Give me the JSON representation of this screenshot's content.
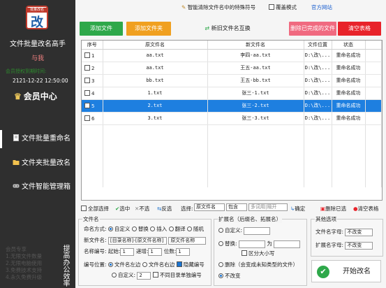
{
  "sidebar": {
    "logo_top": "批量改名",
    "logo_char": "改",
    "app_name": "文件批量改名高手",
    "owner": "与我",
    "valid_label": "会员授权到期时间:",
    "expiry": "2121-12-22 12:50:00",
    "vip": "会员中心",
    "nav": [
      {
        "label": "文件批量重命名"
      },
      {
        "label": "文件夹批量改名"
      },
      {
        "label": "文件智能管理箱"
      }
    ],
    "footer": [
      "会员专享",
      "1.无限文件数量",
      "2.无限电脑使用",
      "3.免费技术支持",
      "4.永久免费升级"
    ],
    "vertical_text": "提高办公效率"
  },
  "top": {
    "remove_special": "智能清除文件名中的特殊符号",
    "overwrite_mode": "覆盖模式",
    "website": "官方网站"
  },
  "buttons": {
    "add_file": "添加文件",
    "add_folder": "添加文件夹",
    "new_file_replace": "新旧文件名互换",
    "remove_done": "删除已完成的文件",
    "clear_list": "清空表格"
  },
  "table": {
    "headers": [
      "序号",
      "原文件名",
      "新文件名",
      "文件位置",
      "状态"
    ],
    "rows": [
      {
        "seq": "1",
        "orig": "aa.txt",
        "new": "李四-aa.txt",
        "path": "D:\\改\\...",
        "status": "重命名成功"
      },
      {
        "seq": "2",
        "orig": "aa.txt",
        "new": "王五-aa.txt",
        "path": "D:\\改\\...",
        "status": "重命名成功"
      },
      {
        "seq": "3",
        "orig": "bb.txt",
        "new": "王五-bb.txt",
        "path": "D:\\改\\...",
        "status": "重命名成功"
      },
      {
        "seq": "4",
        "orig": "1.txt",
        "new": "张三-1.txt",
        "path": "D:\\改\\...",
        "status": "重命名成功"
      },
      {
        "seq": "5",
        "orig": "2.txt",
        "new": "张三-2.txt",
        "path": "D:\\改\\...",
        "status": "重命名成功"
      },
      {
        "seq": "6",
        "orig": "3.txt",
        "new": "张三-3.txt",
        "path": "D:\\改\\...",
        "status": "重命名成功"
      }
    ],
    "selected_index": 4
  },
  "toolbar2": {
    "select_all": "全部选择",
    "selected": "选中",
    "unselected": "不选",
    "invert": "反选",
    "choose": "选择:",
    "field": "原文件名",
    "op": "包含",
    "placeholder": "多词用|隔开",
    "confirm": "确定",
    "delete_selected": "删除已选",
    "clear_table": "清空表格"
  },
  "filename_panel": {
    "title": "文件名",
    "method_label": "命名方式:",
    "methods": [
      "自定义",
      "替换",
      "插入",
      "翻译",
      "随机"
    ],
    "newname_label": "新文件名:",
    "newname_value": "[目录名称]-[原文件名称]",
    "newname_select": "原文件名称",
    "num_label": "名称编号:",
    "start_label": "起始:",
    "start_value": "1",
    "step_label": "递增:",
    "step_value": "1",
    "digits_label": "位数:",
    "digits_value": "1",
    "pos_label": "编号位置:",
    "pos_left": "文件名左边",
    "pos_right": "文件名右边",
    "hide_num": "隐藏编号",
    "custom_label": "自定义:",
    "custom_value": "2",
    "per_dir": "不同目录单独编号"
  },
  "ext_panel": {
    "title": "扩展名（后缀名、拓展名）",
    "custom": "自定义:",
    "replace": "替换:",
    "to": "为",
    "case": "区分大小写",
    "delete": "删除（会变成未知类型的文件）",
    "unchanged": "不改变"
  },
  "other_panel": {
    "title": "其他选项",
    "case_label": "文件名字母:",
    "case_value": "不改变",
    "ext_case_label": "扩展名字母:",
    "ext_case_value": "不改变"
  },
  "start_button": "开始改名",
  "colors": {
    "sidebar": "#2f2f2f",
    "green": "#2ea84a",
    "orange": "#f0a020",
    "pink": "#f06a80",
    "red": "#e8232a",
    "selected": "#1e7fe0"
  }
}
